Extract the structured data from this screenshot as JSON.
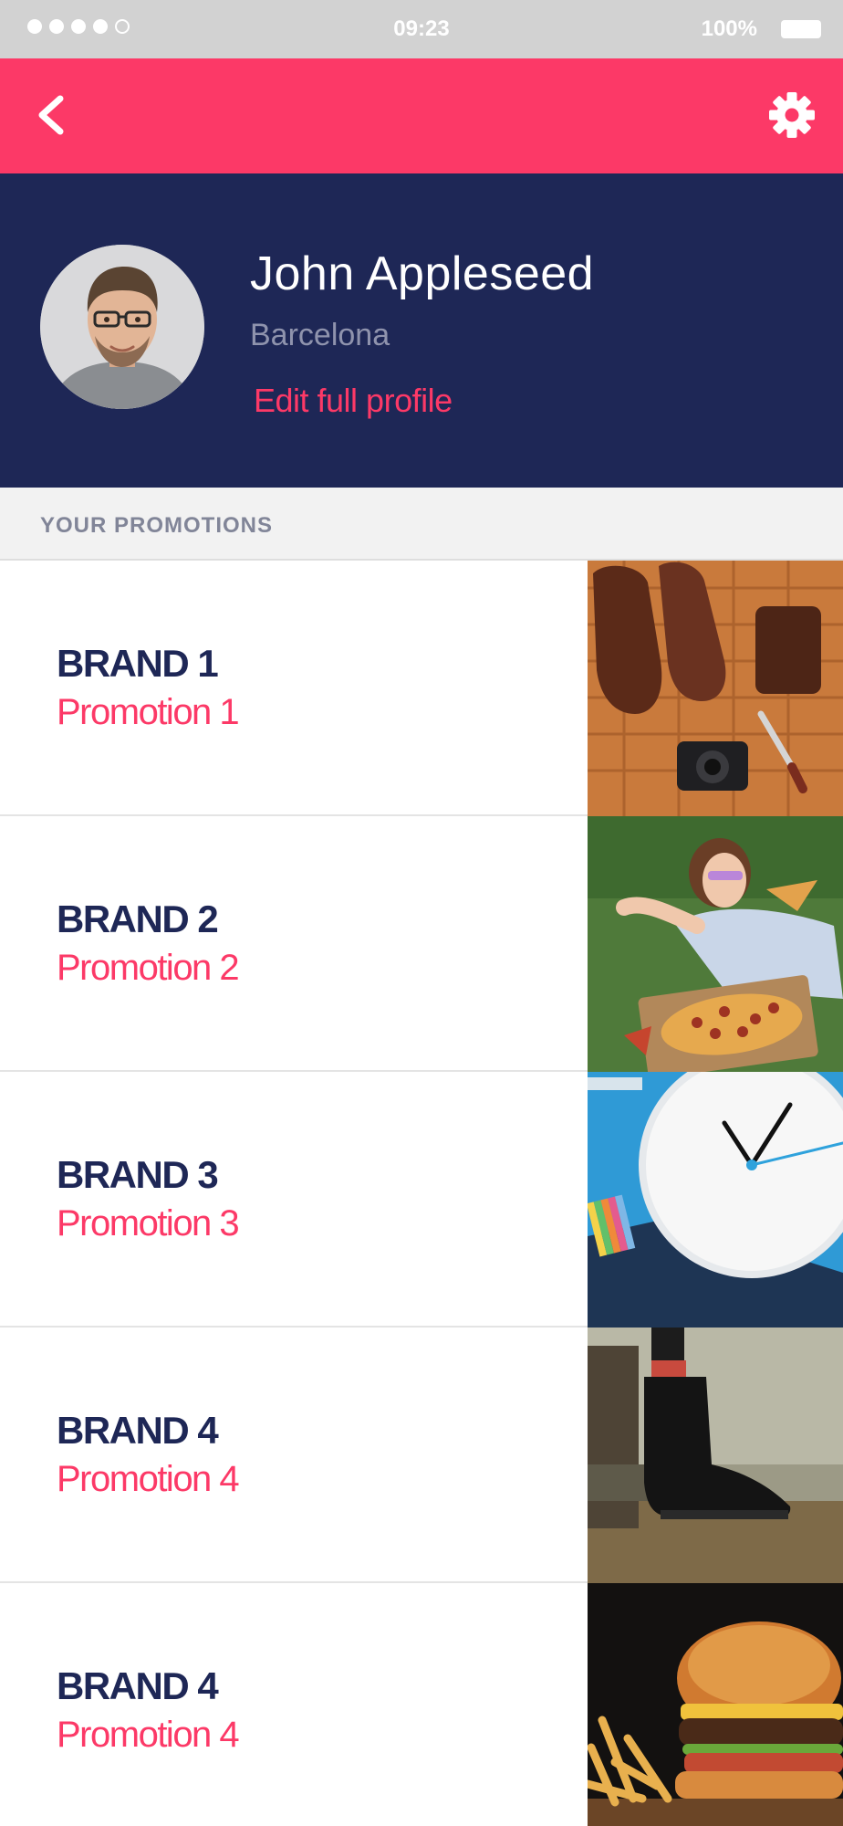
{
  "status_bar": {
    "time": "09:23",
    "battery": "100%",
    "signal_bars": 4
  },
  "nav": {
    "back_icon": "chevron-left-icon",
    "settings_icon": "gear-icon"
  },
  "profile": {
    "name": "John Appleseed",
    "city": "Barcelona",
    "edit_link": "Edit full profile"
  },
  "section": {
    "title": "YOUR PROMOTIONS"
  },
  "promotions": [
    {
      "brand": "BRAND 1",
      "promo": "Promotion 1",
      "image": "boots-and-camera-photo"
    },
    {
      "brand": "BRAND 2",
      "promo": "Promotion 2",
      "image": "girl-with-pizza-photo"
    },
    {
      "brand": "BRAND 3",
      "promo": "Promotion 3",
      "image": "wall-clock-photo"
    },
    {
      "brand": "BRAND 4",
      "promo": "Promotion 4",
      "image": "boot-jumping-photo"
    },
    {
      "brand": "BRAND 4",
      "promo": "Promotion 4",
      "image": "burger-and-fries-photo"
    }
  ],
  "colors": {
    "accent": "#fc3967",
    "navy": "#1e2756",
    "status_bar": "#d2d2d2",
    "section_bg": "#f2f2f2"
  }
}
